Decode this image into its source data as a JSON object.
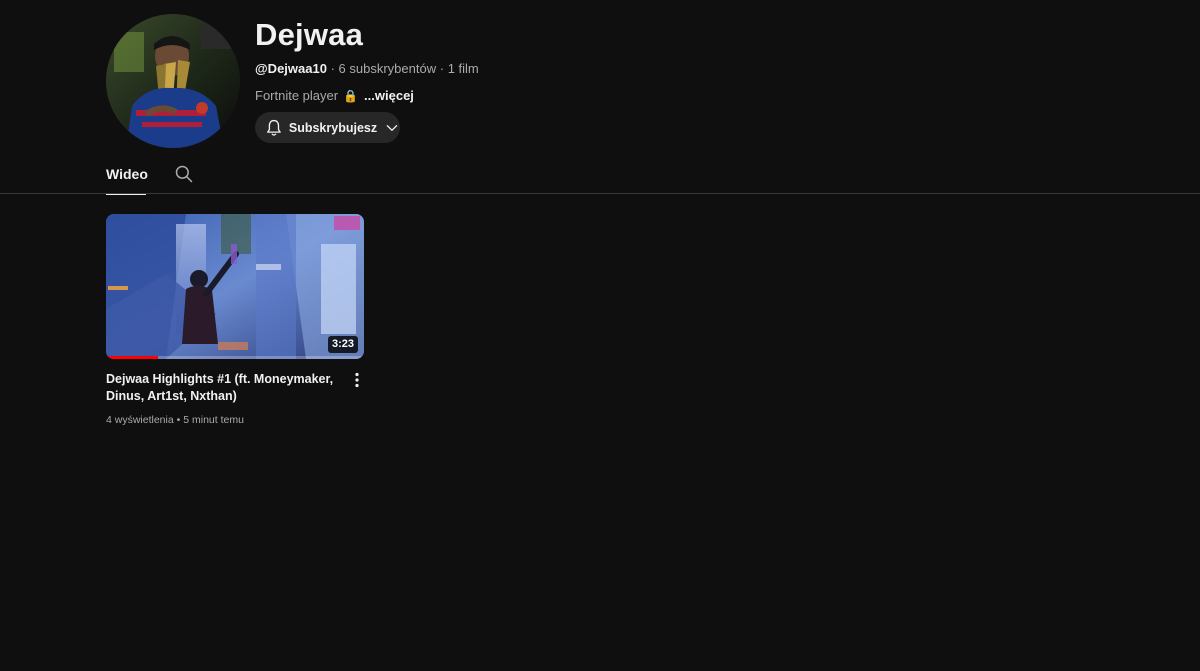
{
  "channel": {
    "name": "Dejwaa",
    "handle": "@Dejwaa10",
    "separator": "·",
    "subscribers": "6 subskrybentów",
    "videos_count": "1 film",
    "description": "Fortnite player",
    "description_emoji": "🔒",
    "more_label": "...więcej",
    "subscribe_label": "Subskrybujesz"
  },
  "tabs": [
    {
      "label": "Wideo",
      "active": true
    }
  ],
  "icons": {
    "bell": "bell-icon",
    "chevron": "chevron-down-icon",
    "search": "search-icon",
    "kebab": "more-vertical-icon"
  },
  "videos": [
    {
      "title": "Dejwaa Highlights #1 (ft. Moneymaker, Dinus, Art1st, Nxthan)",
      "duration": "3:23",
      "views": "4 wyświetlenia",
      "meta_separator": "•",
      "age": "5 minut temu",
      "watched_fraction": 0.2
    }
  ],
  "colors": {
    "background": "#0f0f0f",
    "text_primary": "#f1f1f1",
    "text_secondary": "#aaaaaa",
    "button_bg": "#272727",
    "progress": "#ff0000"
  }
}
